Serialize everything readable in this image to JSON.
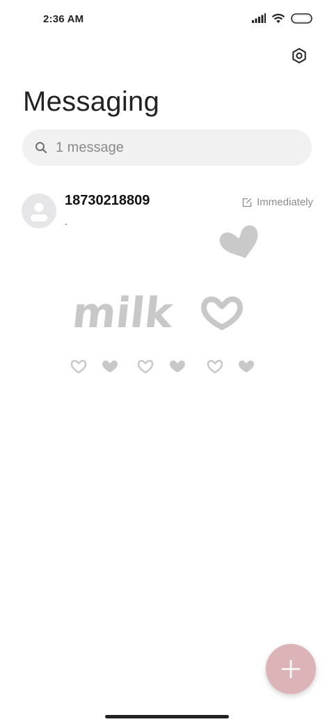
{
  "status_bar": {
    "time": "2:36 AM",
    "icons": [
      "cell-signal-icon",
      "wifi-icon",
      "battery-icon"
    ]
  },
  "header": {
    "title": "Messaging",
    "settings_icon": "settings-hexagon-icon"
  },
  "search": {
    "placeholder": "1 message",
    "value": ""
  },
  "conversations": [
    {
      "name": "18730218809",
      "snippet": ".",
      "time": "Immediately",
      "time_icon": "edit-draft-icon"
    }
  ],
  "wallpaper": {
    "text": "milk"
  },
  "fab": {
    "icon": "plus-icon",
    "color": "#dcb3b6"
  }
}
